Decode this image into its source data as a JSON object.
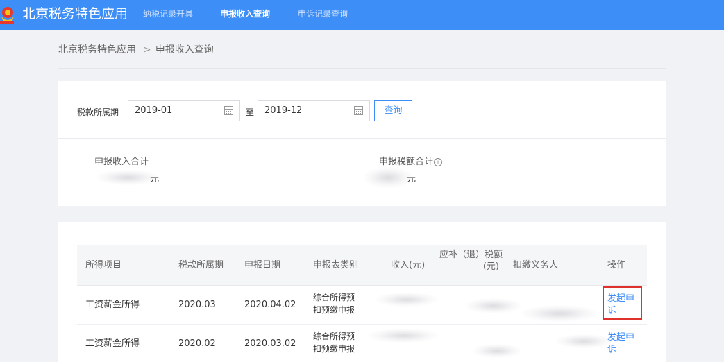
{
  "header": {
    "app_title": "北京税务特色应用",
    "nav": [
      {
        "label": "纳税记录开具",
        "active": false
      },
      {
        "label": "申报收入查询",
        "active": true
      },
      {
        "label": "申诉记录查询",
        "active": false
      }
    ]
  },
  "breadcrumb": {
    "root": "北京税务特色应用",
    "separator": ">",
    "current": "申报收入查询"
  },
  "filter": {
    "label": "税款所属期",
    "start_value": "2019-01",
    "to_label": "至",
    "end_value": "2019-12",
    "query_label": "查询"
  },
  "summary": {
    "income_label": "申报收入合计",
    "income_unit": "元",
    "tax_label": "申报税额合计",
    "tax_unit": "元",
    "info_icon": "i"
  },
  "table": {
    "headers": {
      "item": "所得项目",
      "period": "税款所属期",
      "date": "申报日期",
      "type": "申报表类别",
      "income": "收入(元)",
      "tax_line1": "应补（退）税额",
      "tax_line2": "(元)",
      "withholder": "扣缴义务人",
      "action": "操作"
    },
    "rows": [
      {
        "item": "工资薪金所得",
        "period": "2020.03",
        "date": "2020.04.02",
        "type_line1": "综合所得预",
        "type_line2": "扣预缴申报",
        "action": "发起申诉"
      },
      {
        "item": "工资薪金所得",
        "period": "2020.02",
        "date": "2020.03.02",
        "type_line1": "综合所得预",
        "type_line2": "扣预缴申报",
        "action": "发起申诉"
      }
    ]
  },
  "colors": {
    "topbar": "#3e8ef7",
    "link": "#3e8ef7",
    "highlight_box": "#e0322c"
  }
}
